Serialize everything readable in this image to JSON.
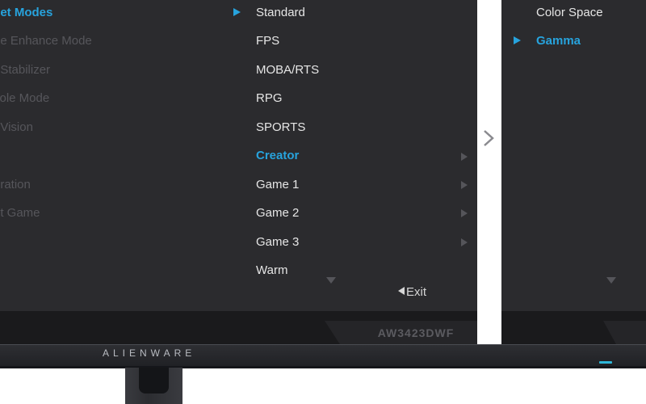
{
  "left_menu": {
    "items": [
      {
        "label": "set Modes",
        "active": true
      },
      {
        "label": "ne Enhance Mode",
        "active": false
      },
      {
        "label": "t Stabilizer",
        "active": false
      },
      {
        "label": "sole Mode",
        "active": false
      },
      {
        "label": "nVision",
        "active": false
      },
      {
        "label": "oration",
        "active": false
      },
      {
        "label": "et Game",
        "active": false
      }
    ]
  },
  "preset_menu": {
    "items": [
      {
        "label": "Standard",
        "selected_marker": true,
        "has_submenu": false
      },
      {
        "label": "FPS",
        "has_submenu": false
      },
      {
        "label": "MOBA/RTS",
        "has_submenu": false
      },
      {
        "label": "RPG",
        "has_submenu": false
      },
      {
        "label": "SPORTS",
        "has_submenu": false
      },
      {
        "label": "Creator",
        "active": true,
        "has_submenu": true
      },
      {
        "label": "Game 1",
        "has_submenu": true
      },
      {
        "label": "Game 2",
        "has_submenu": true
      },
      {
        "label": "Game 3",
        "has_submenu": true
      },
      {
        "label": "Warm",
        "has_submenu": false
      }
    ],
    "exit_label": "Exit"
  },
  "sub_menu": {
    "items": [
      {
        "label": "Color Space",
        "active": false
      },
      {
        "label": "Gamma",
        "active": true
      }
    ]
  },
  "monitor": {
    "model": "AW3423DWF",
    "brand": "ALIENWARE",
    "led_color": "#2fb7d9"
  },
  "colors": {
    "accent": "#27a3dd",
    "panel_bg": "#2b2b2e",
    "text": "#e6e6e6",
    "disabled_text": "#56565b"
  },
  "icons": [
    "play-triangle-icon",
    "chevron-right-icon",
    "chevron-down-icon",
    "back-triangle-icon"
  ]
}
